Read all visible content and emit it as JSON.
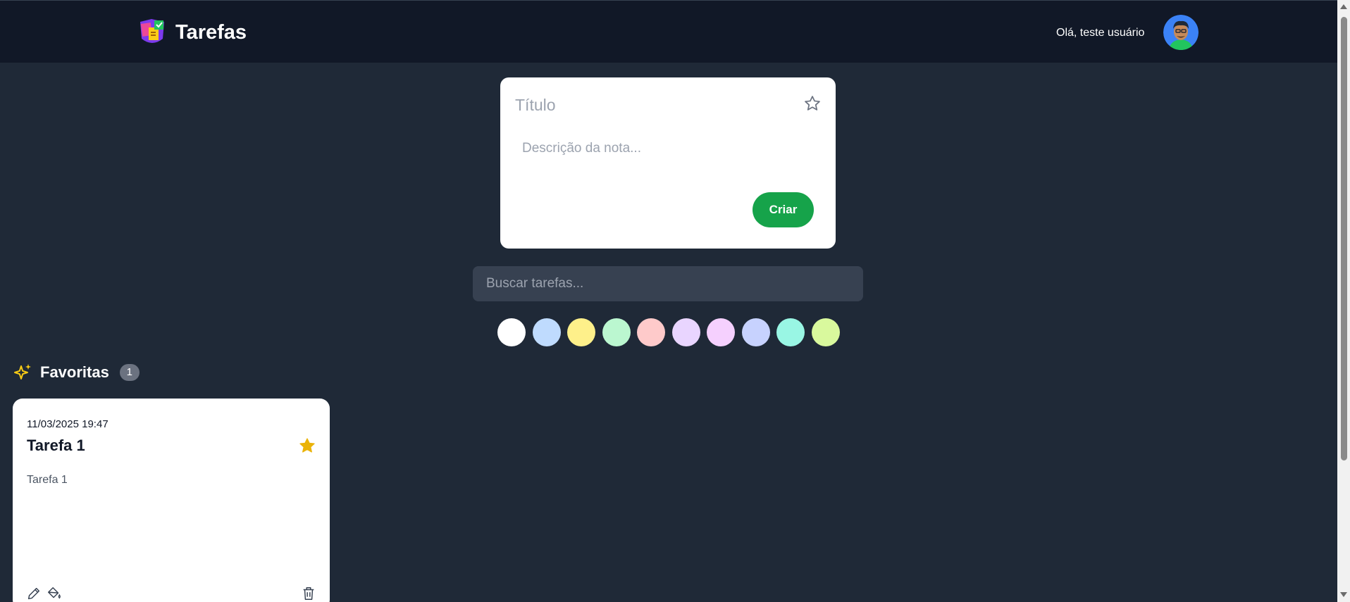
{
  "header": {
    "app_title": "Tarefas",
    "greeting": "Olá, teste usuário",
    "logo_icon": "sticky-notes-logo-icon",
    "avatar_icon": "user-avatar"
  },
  "create_note": {
    "title_placeholder": "Título",
    "description_placeholder": "Descrição da nota...",
    "create_label": "Criar",
    "favorite_icon": "star-outline-icon",
    "button_color": "#16a34a"
  },
  "search": {
    "placeholder": "Buscar tarefas..."
  },
  "color_filters": [
    {
      "name": "white",
      "color": "#ffffff"
    },
    {
      "name": "blue",
      "color": "#bfdbfe"
    },
    {
      "name": "yellow",
      "color": "#fef08a"
    },
    {
      "name": "green",
      "color": "#bbf7d0"
    },
    {
      "name": "red",
      "color": "#fecaca"
    },
    {
      "name": "purple",
      "color": "#e9d5ff"
    },
    {
      "name": "pink",
      "color": "#f5d0fe"
    },
    {
      "name": "indigo",
      "color": "#c7d2fe"
    },
    {
      "name": "teal",
      "color": "#99f6e4"
    },
    {
      "name": "lime",
      "color": "#d9f99d"
    }
  ],
  "favorites": {
    "label": "Favoritas",
    "count": "1",
    "icon": "sparkles-icon",
    "icon_color": "#facc15",
    "tasks": [
      {
        "date": "11/03/2025 19:47",
        "title": "Tarefa 1",
        "description": "Tarefa 1",
        "favorite": true,
        "star_color": "#eab308"
      }
    ]
  },
  "colors": {
    "page_background": "#1f2937",
    "header_background": "#111827"
  }
}
